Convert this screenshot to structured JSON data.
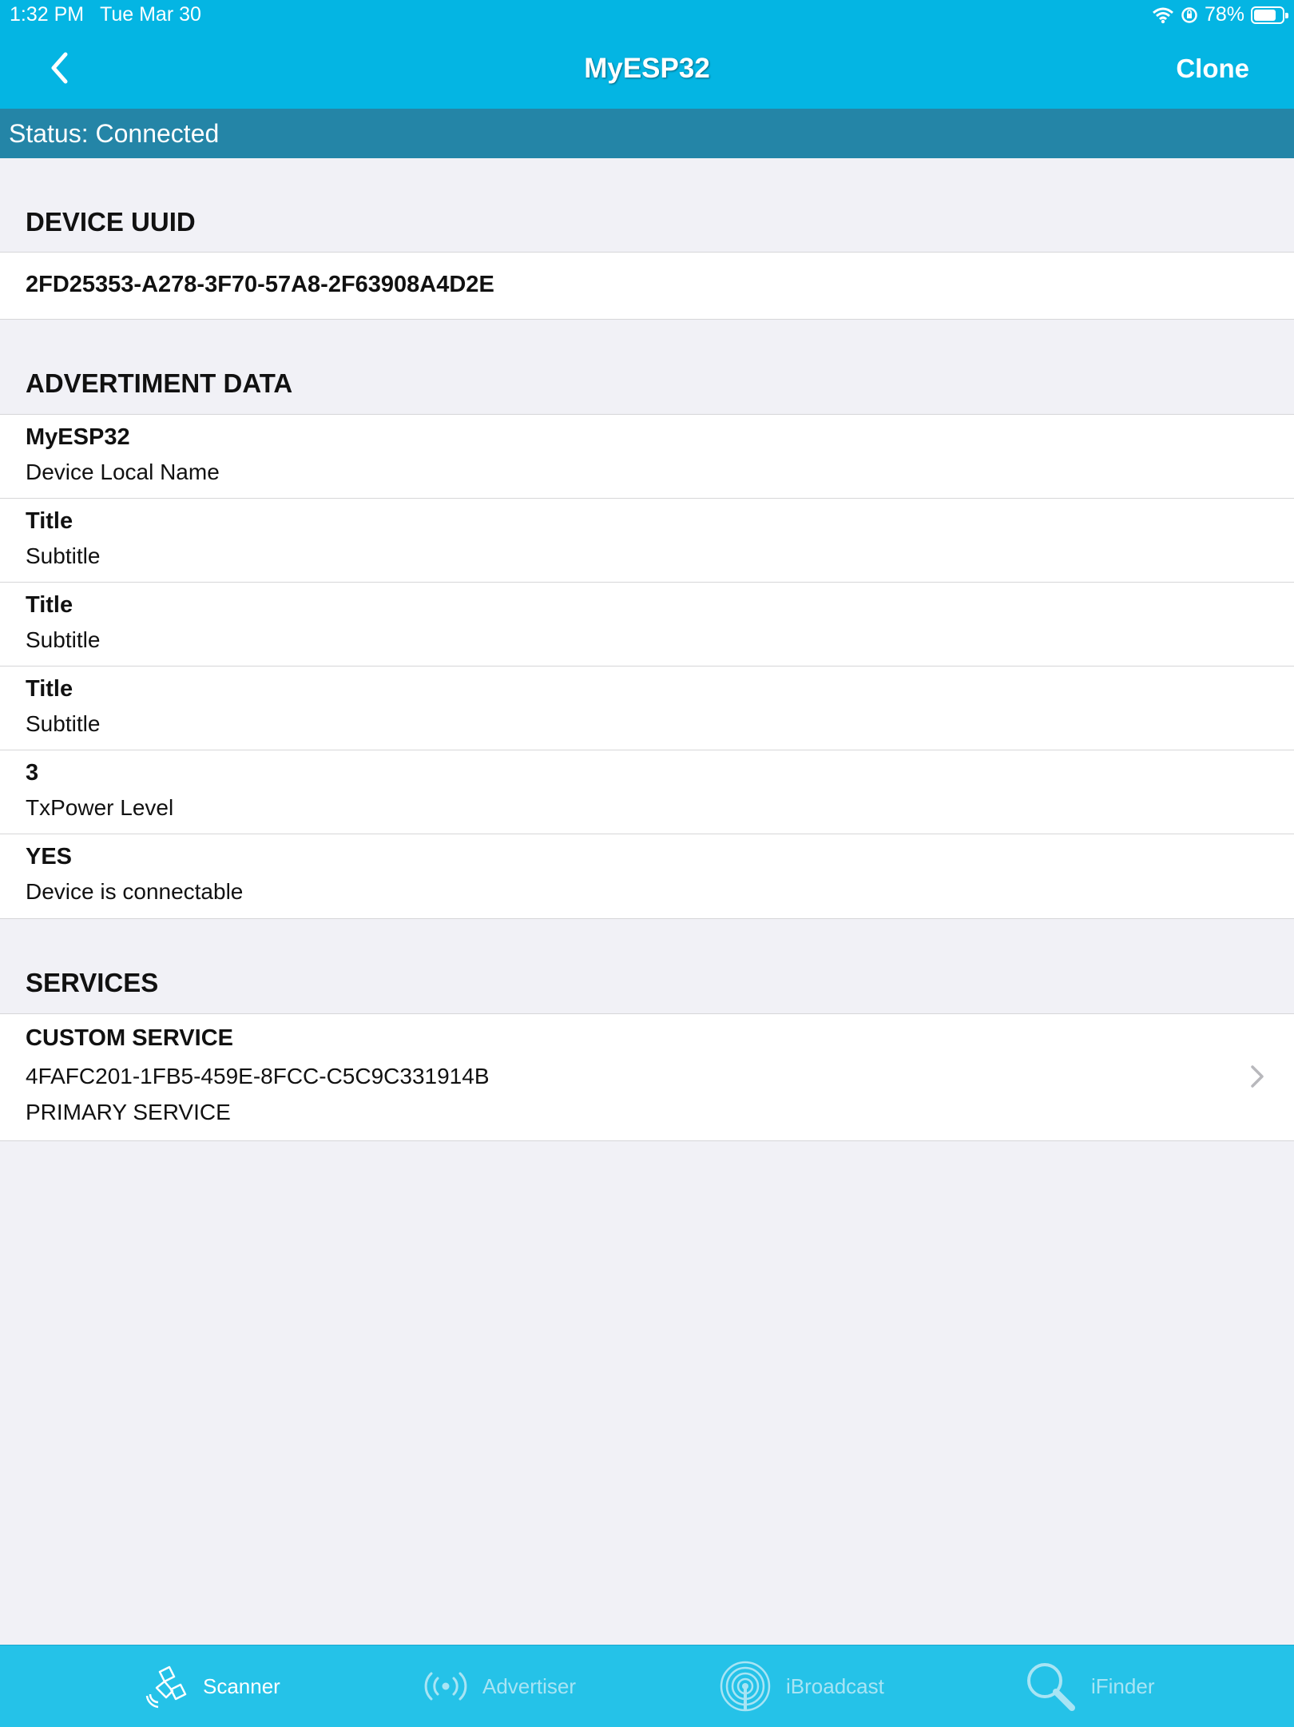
{
  "status_bar": {
    "time": "1:32 PM",
    "date": "Tue Mar 30",
    "battery": "78%",
    "battery_level": 0.78
  },
  "nav": {
    "title": "MyESP32",
    "right_action": "Clone",
    "back_icon": "chevron-left-icon"
  },
  "connection": {
    "status": "Status: Connected"
  },
  "device_uuid": {
    "header": "DEVICE UUID",
    "value": "2FD25353-A278-3F70-57A8-2F63908A4D2E"
  },
  "advertisement": {
    "header": "ADVERTIMENT DATA",
    "rows": [
      {
        "title": "MyESP32",
        "subtitle": "Device Local Name"
      },
      {
        "title": "Title",
        "subtitle": "Subtitle"
      },
      {
        "title": "Title",
        "subtitle": "Subtitle"
      },
      {
        "title": "Title",
        "subtitle": "Subtitle"
      },
      {
        "title": "3",
        "subtitle": "TxPower Level"
      },
      {
        "title": "YES",
        "subtitle": "Device is connectable"
      }
    ]
  },
  "services": {
    "header": "SERVICES",
    "items": [
      {
        "name": "CUSTOM SERVICE",
        "uuid": "4FAFC201-1FB5-459E-8FCC-C5C9C331914B",
        "type": "PRIMARY SERVICE"
      }
    ]
  },
  "tabs": [
    {
      "label": "Scanner",
      "icon": "satellite-icon",
      "active": true
    },
    {
      "label": "Advertiser",
      "icon": "broadcast-waves-icon",
      "active": false
    },
    {
      "label": "iBroadcast",
      "icon": "beacon-icon",
      "active": false
    },
    {
      "label": "iFinder",
      "icon": "magnifier-icon",
      "active": false
    }
  ],
  "colors": {
    "accent": "#04b5e3",
    "status_strip": "#2485a7",
    "tab_bar": "#25c2e8",
    "background": "#f1f1f6"
  }
}
